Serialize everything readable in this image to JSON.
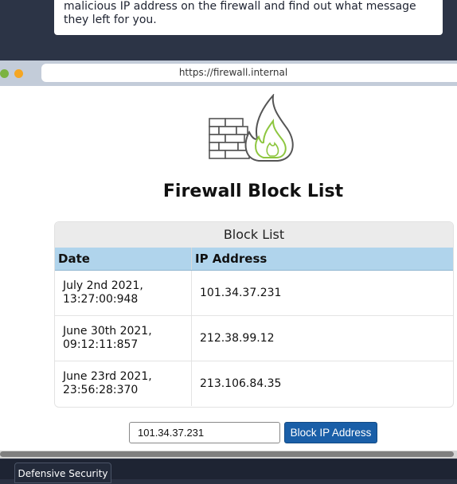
{
  "instruction": {
    "line1": "malicious IP address on the firewall and find out what message",
    "line2": "they left for you."
  },
  "browser": {
    "url": "https://firewall.internal"
  },
  "page": {
    "title": "Firewall Block List",
    "logo_icon": "firewall-flame-icon",
    "colors": {
      "header_blue": "#b0d4ec",
      "button_blue": "#1a5fa8",
      "flame_green": "#8dc63f"
    }
  },
  "block_list": {
    "heading": "Block List",
    "columns": [
      "Date",
      "IP Address"
    ],
    "rows": [
      {
        "date_line1": "July 2nd 2021,",
        "date_line2": "13:27:00:948",
        "ip": "101.34.37.231"
      },
      {
        "date_line1": "June 30th 2021,",
        "date_line2": "09:12:11:857",
        "ip": "212.38.99.12"
      },
      {
        "date_line1": "June 23rd 2021,",
        "date_line2": "23:56:28:370",
        "ip": "213.106.84.35"
      }
    ]
  },
  "form": {
    "ip_value": "101.34.37.231",
    "button_label": "Block IP Address"
  },
  "footer": {
    "tab_label": "Defensive Security"
  }
}
